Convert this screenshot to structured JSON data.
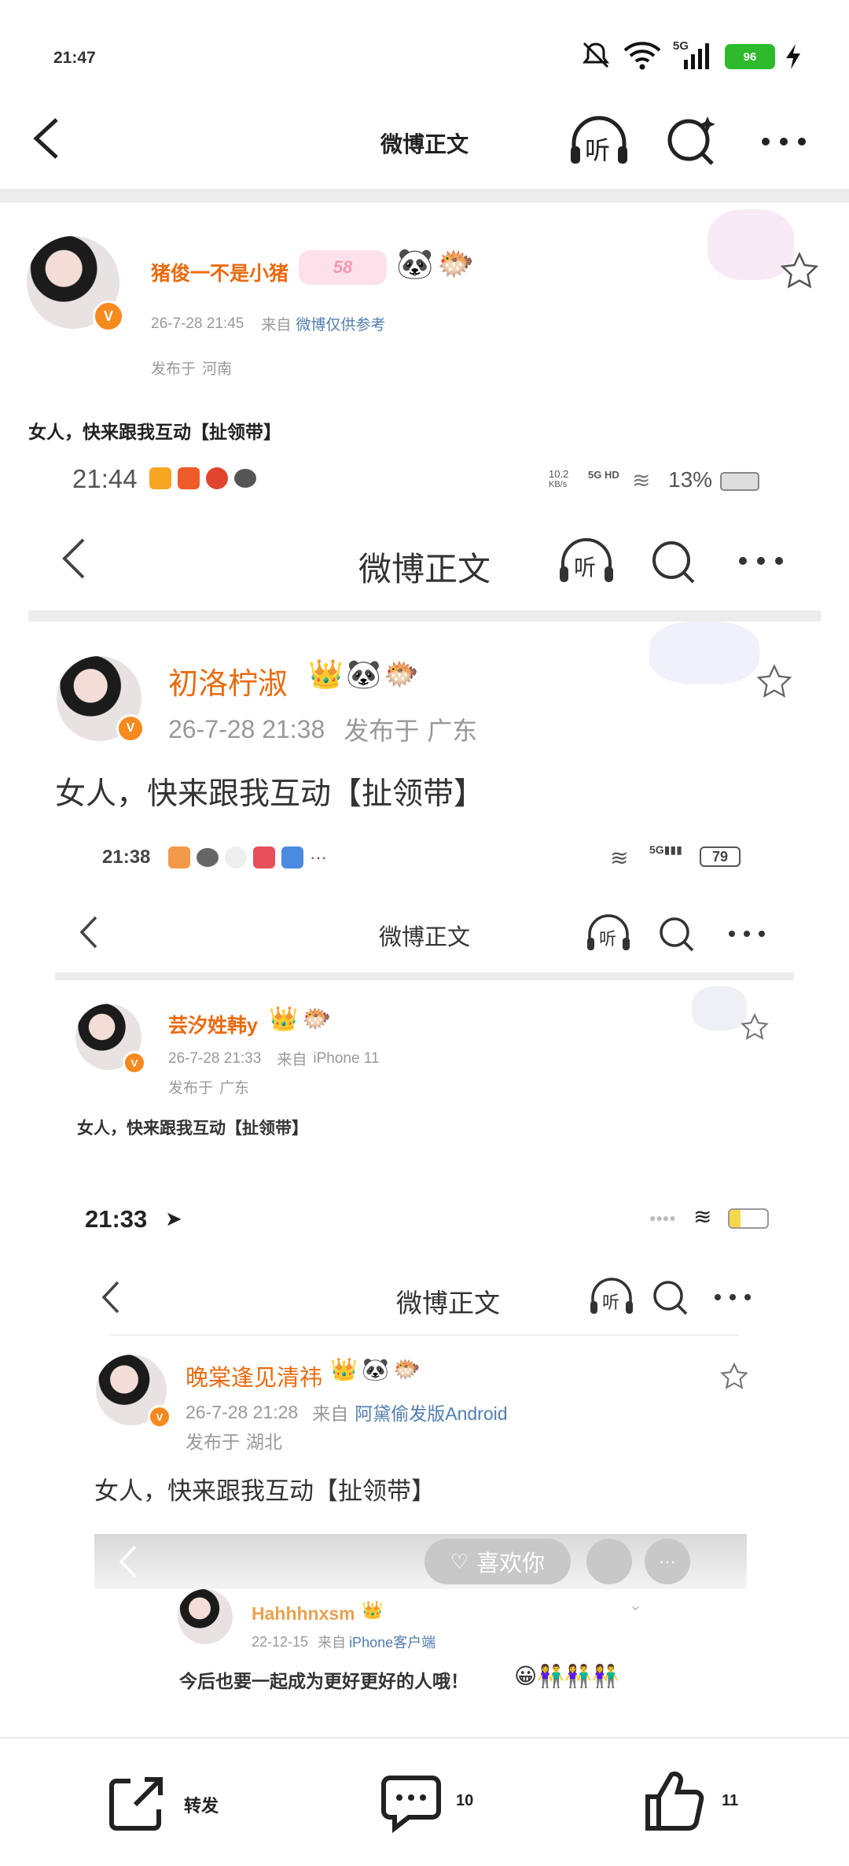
{
  "status": {
    "time": "21:47",
    "network": "5G",
    "battery": "96"
  },
  "nav": {
    "title": "微博正文",
    "listen_label": "听"
  },
  "post": {
    "username": "猪俊一不是小猪",
    "badge": "58",
    "date": "26-7-28 21:45",
    "source_prefix": "来自",
    "source": "微博仅供参考",
    "location_prefix": "发布于",
    "location": "河南",
    "text": "女人，快来跟我互动【扯领带】"
  },
  "nested1": {
    "status_time": "21:44",
    "speed": "10.2",
    "speed_unit": "KB/s",
    "net": "5G HD",
    "battery": "13%",
    "title": "微博正文",
    "listen_label": "听",
    "username": "初洛柠淑",
    "date": "26-7-28 21:38",
    "location_prefix": "发布于",
    "location": "广东",
    "text": "女人，快来跟我互动【扯领带】"
  },
  "nested2": {
    "status_time": "21:38",
    "battery": "79",
    "title": "微博正文",
    "listen_label": "听",
    "username": "芸汐姓韩y",
    "date": "26-7-28 21:33",
    "source_prefix": "来自",
    "source": "iPhone 11",
    "location_prefix": "发布于",
    "location": "广东",
    "text": "女人，快来跟我互动【扯领带】"
  },
  "nested3": {
    "status_time": "21:33",
    "title": "微博正文",
    "listen_label": "听",
    "username": "晚棠逢见清祎",
    "date": "26-7-28 21:28",
    "source_prefix": "来自",
    "source": "阿黛偷发版Android",
    "location_prefix": "发布于",
    "location": "湖北",
    "text": "女人，快来跟我互动【扯领带】"
  },
  "nested4": {
    "like_label": "喜欢你",
    "username": "Hahhhnxsm",
    "date": "22-12-15",
    "source_prefix": "来自",
    "source": "iPhone客户端",
    "text": "今后也要一起成为更好更好的人哦！"
  },
  "actions": {
    "repost_label": "转发",
    "comment_count": "10",
    "like_count": "11"
  },
  "colors": {
    "accent": "#e86b0f",
    "link": "#507daf",
    "battery": "#2dbb2d"
  }
}
